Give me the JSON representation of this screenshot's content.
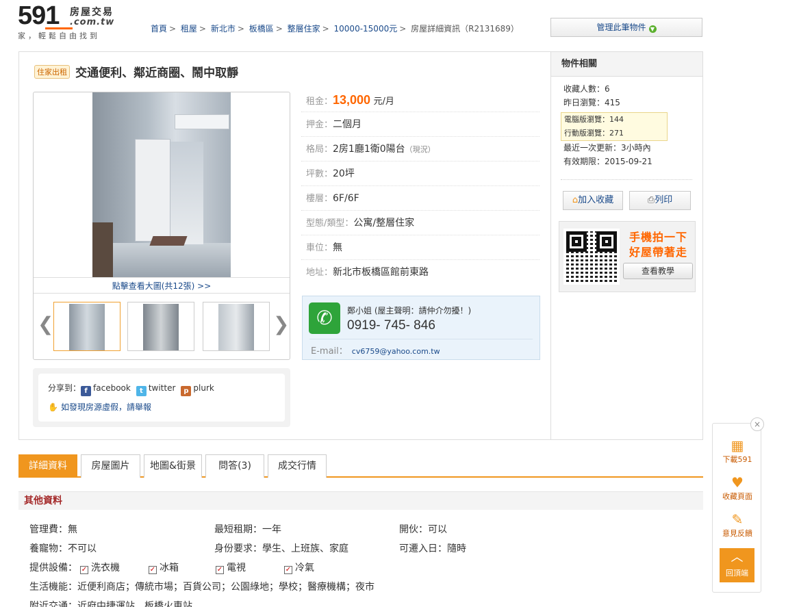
{
  "header": {
    "logo_num": "591",
    "logo_cn": "房屋交易",
    "logo_domain": ".com.tw",
    "slogan": "家，輕鬆自由找到",
    "breadcrumb": [
      "首頁",
      "租屋",
      "新北市",
      "板橋區",
      "整層住家",
      "10000-15000元"
    ],
    "breadcrumb_current": "房屋詳細資訊（R2131689）",
    "manage_button": "管理此筆物件"
  },
  "listing": {
    "tag": "住家出租",
    "title": "交通便利、鄰近商圈、鬧中取靜",
    "view_large": "點擊查看大圖(共12張) >>",
    "info": {
      "rent_label": "租金：",
      "rent_value": "13,000",
      "rent_unit": "元/月",
      "deposit_label": "押金：",
      "deposit_value": "二個月",
      "layout_label": "格局：",
      "layout_value": "2房1廳1衛0陽台",
      "layout_note": "（現況）",
      "area_label": "坪數：",
      "area_value": "20坪",
      "floor_label": "樓層：",
      "floor_value": "6F/6F",
      "type_label": "型態/類型：",
      "type_value": "公寓/整層住家",
      "parking_label": "車位：",
      "parking_value": "無",
      "address_label": "地址：",
      "address_value": "新北市板橋區館前東路"
    },
    "contact": {
      "name": "鄭小姐 (屋主聲明：請仲介勿擾！)",
      "phone": "0919- 745- 846",
      "email_label": "E-mail：",
      "email": "cv6759@yahoo.com.tw"
    },
    "share": {
      "label": "分享到：",
      "facebook": "facebook",
      "twitter": "twitter",
      "plurk": "plurk",
      "report": "如發現房源虛假，請舉報"
    }
  },
  "sidebar": {
    "title": "物件相關",
    "favorites": "收藏人數：6",
    "yesterday_views": "昨日瀏覽：415",
    "pc_views": "電腦版瀏覽：144",
    "mobile_views": "行動版瀏覽：271",
    "last_update": "最近一次更新：3小時內",
    "expiry": "有效期限：2015-09-21",
    "fav_button": "加入收藏",
    "print_button": "列印",
    "qr_line1": "手機拍一下",
    "qr_line2": "好屋帶著走",
    "qr_button": "查看教學"
  },
  "tabs": [
    "詳細資料",
    "房屋圖片",
    "地圖&街景",
    "問答(3)",
    "成交行情"
  ],
  "details": {
    "section_title": "其他資料",
    "mgmt_fee": "管理費：無",
    "min_lease": "最短租期：一年",
    "cooking": "開伙：可以",
    "pets": "養寵物：不可以",
    "identity": "身份要求：學生、上班族、家庭",
    "move_in": "可遷入日：隨時",
    "equip_label": "提供設備：",
    "equipment": [
      "洗衣機",
      "冰箱",
      "電視",
      "冷氣"
    ],
    "life": "生活機能：近便利商店；傳統市場；百貨公司；公園綠地；學校；醫療機構；夜市",
    "transport": "附近交通：近府中捷運站、板橋火車站"
  },
  "float": {
    "download": "下載591",
    "collect": "收藏頁面",
    "feedback": "意見反饋",
    "top": "回頂端"
  }
}
